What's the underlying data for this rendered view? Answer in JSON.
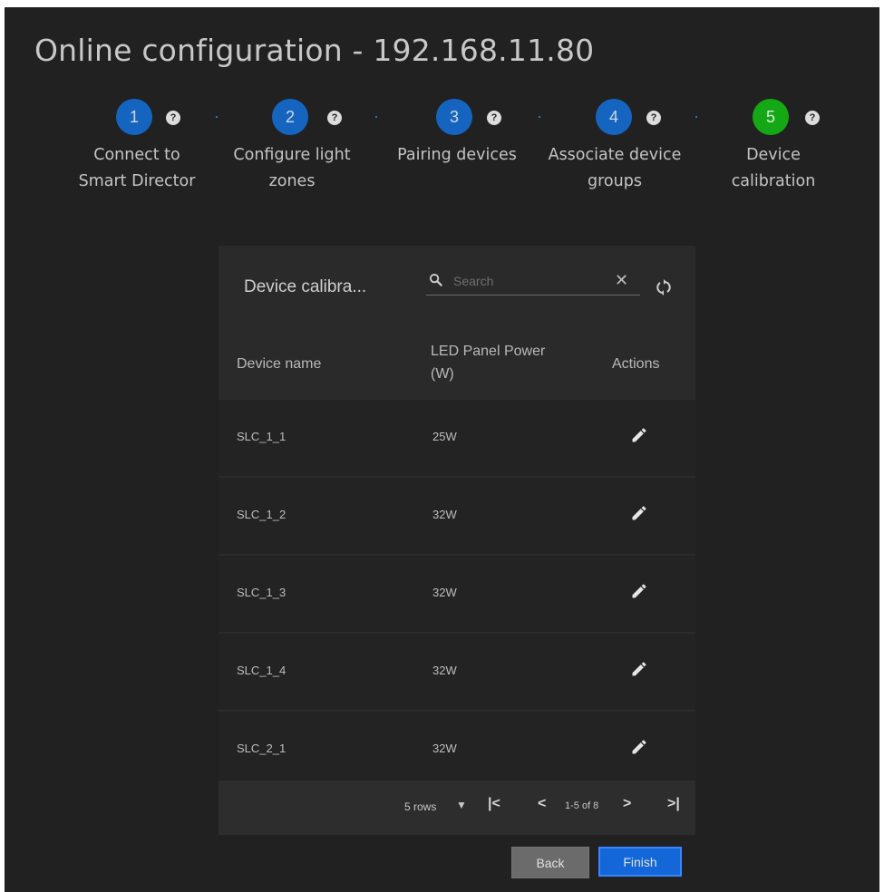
{
  "window": {
    "title": "Online configuration - 192.168.11.80"
  },
  "stepper": {
    "help_glyph": "?",
    "steps": [
      {
        "number": "1",
        "label": "Connect to\nSmart Director",
        "status": "complete",
        "color": "#1565c0"
      },
      {
        "number": "2",
        "label": "Configure light\nzones",
        "status": "complete",
        "color": "#1565c0"
      },
      {
        "number": "3",
        "label": "Pairing devices",
        "status": "complete",
        "color": "#1565c0"
      },
      {
        "number": "4",
        "label": "Associate device\ngroups",
        "status": "complete",
        "color": "#1565c0"
      },
      {
        "number": "5",
        "label": "Device\ncalibration",
        "status": "active",
        "color": "#14a814"
      }
    ]
  },
  "table": {
    "title": "Device calibra...",
    "search": {
      "placeholder": "Search",
      "value": "",
      "clear_glyph": "✕"
    },
    "columns": {
      "name": "Device name",
      "power": "LED Panel Power\n(W)",
      "actions": "Actions"
    },
    "rows": [
      {
        "name": "SLC_1_1",
        "power": "25W"
      },
      {
        "name": "SLC_1_2",
        "power": "32W"
      },
      {
        "name": "SLC_1_3",
        "power": "32W"
      },
      {
        "name": "SLC_1_4",
        "power": "32W"
      },
      {
        "name": "SLC_2_1",
        "power": "32W"
      }
    ],
    "pagination": {
      "rows_per_page": "5 rows",
      "caret": "▼",
      "first": "|<",
      "prev": "<",
      "range": "1-5 of 8",
      "next": ">",
      "last": ">|"
    }
  },
  "buttons": {
    "back": "Back",
    "finish": "Finish"
  },
  "colors": {
    "background": "#212121",
    "card": "#2a2a2a",
    "step_complete": "#1565c0",
    "step_active": "#14a814",
    "finish_button": "#1467d8",
    "back_button": "#6b6b6b"
  },
  "icons": [
    "help-icon",
    "search-icon",
    "close-icon",
    "refresh-icon",
    "edit-icon",
    "chevron-down-icon",
    "first-page-icon",
    "prev-page-icon",
    "next-page-icon",
    "last-page-icon"
  ]
}
